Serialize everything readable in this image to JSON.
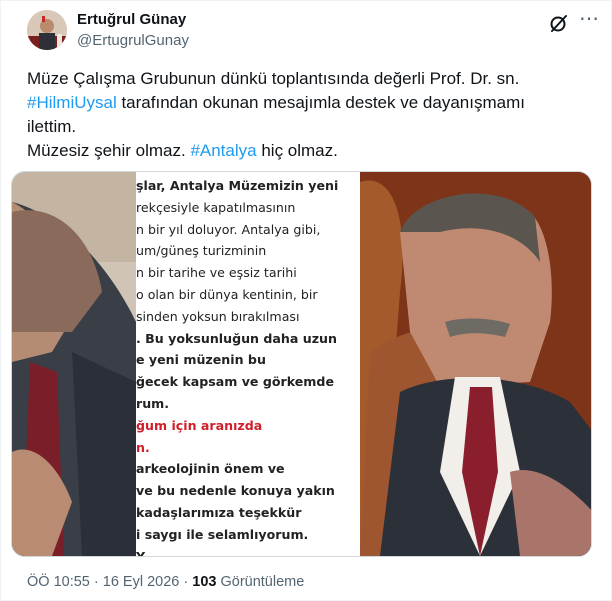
{
  "author": {
    "name": "Ertuğrul Günay",
    "handle": "@ErtugrulGunay"
  },
  "icons": {
    "avatar": "profile-photo",
    "grok": "grok-slash-icon",
    "more": "more-dots-icon"
  },
  "tweet": {
    "line1": "Müze Çalışma Grubunun dünkü toplantısında değerli Prof. Dr. sn.",
    "hashtag1": "#HilmiUysal",
    "line2_rest": " tarafından okunan mesajımla destek ve dayanışmamı",
    "line3": "ilettim.",
    "line4_start": "Müzesiz şehir olmaz. ",
    "hashtag2": "#Antalya",
    "line4_end": " hiç olmaz."
  },
  "document_lines": [
    {
      "text": "şlar, Antalya Müzemizin yeni",
      "style": "b"
    },
    {
      "text": "rekçesiyle kapatılmasının",
      "style": ""
    },
    {
      "text": "n bir yıl doluyor. Antalya gibi,",
      "style": ""
    },
    {
      "text": "um/güneş turizminin",
      "style": ""
    },
    {
      "text": "n bir tarihe ve eşsiz tarihi",
      "style": ""
    },
    {
      "text": "o olan bir dünya kentinin, bir",
      "style": ""
    },
    {
      "text": "sinden yoksun bırakılması",
      "style": ""
    },
    {
      "text": ". Bu yoksunluğun daha uzun",
      "style": "b"
    },
    {
      "text": "e yeni müzenin bu",
      "style": "b"
    },
    {
      "text": "ğecek kapsam ve görkemde",
      "style": "b"
    },
    {
      "text": "rum.",
      "style": "b"
    },
    {
      "text": "ğum için aranızda",
      "style": "r"
    },
    {
      "text": "n.",
      "style": "r"
    },
    {
      "text": "arkeolojinin önem ve",
      "style": "b"
    },
    {
      "text": "ve bu nedenle konuya yakın",
      "style": "b"
    },
    {
      "text": "kadaşlarımıza teşekkür",
      "style": "b"
    },
    {
      "text": "i saygı ile selamlıyorum.",
      "style": "b"
    },
    {
      "text": "Y",
      "style": "b"
    }
  ],
  "meta": {
    "time": "ÖÖ 10:55",
    "separator1": " · ",
    "date": "16 Eyl 2026",
    "separator2": " · ",
    "views_count": "103",
    "views_label": " Görüntüleme"
  }
}
